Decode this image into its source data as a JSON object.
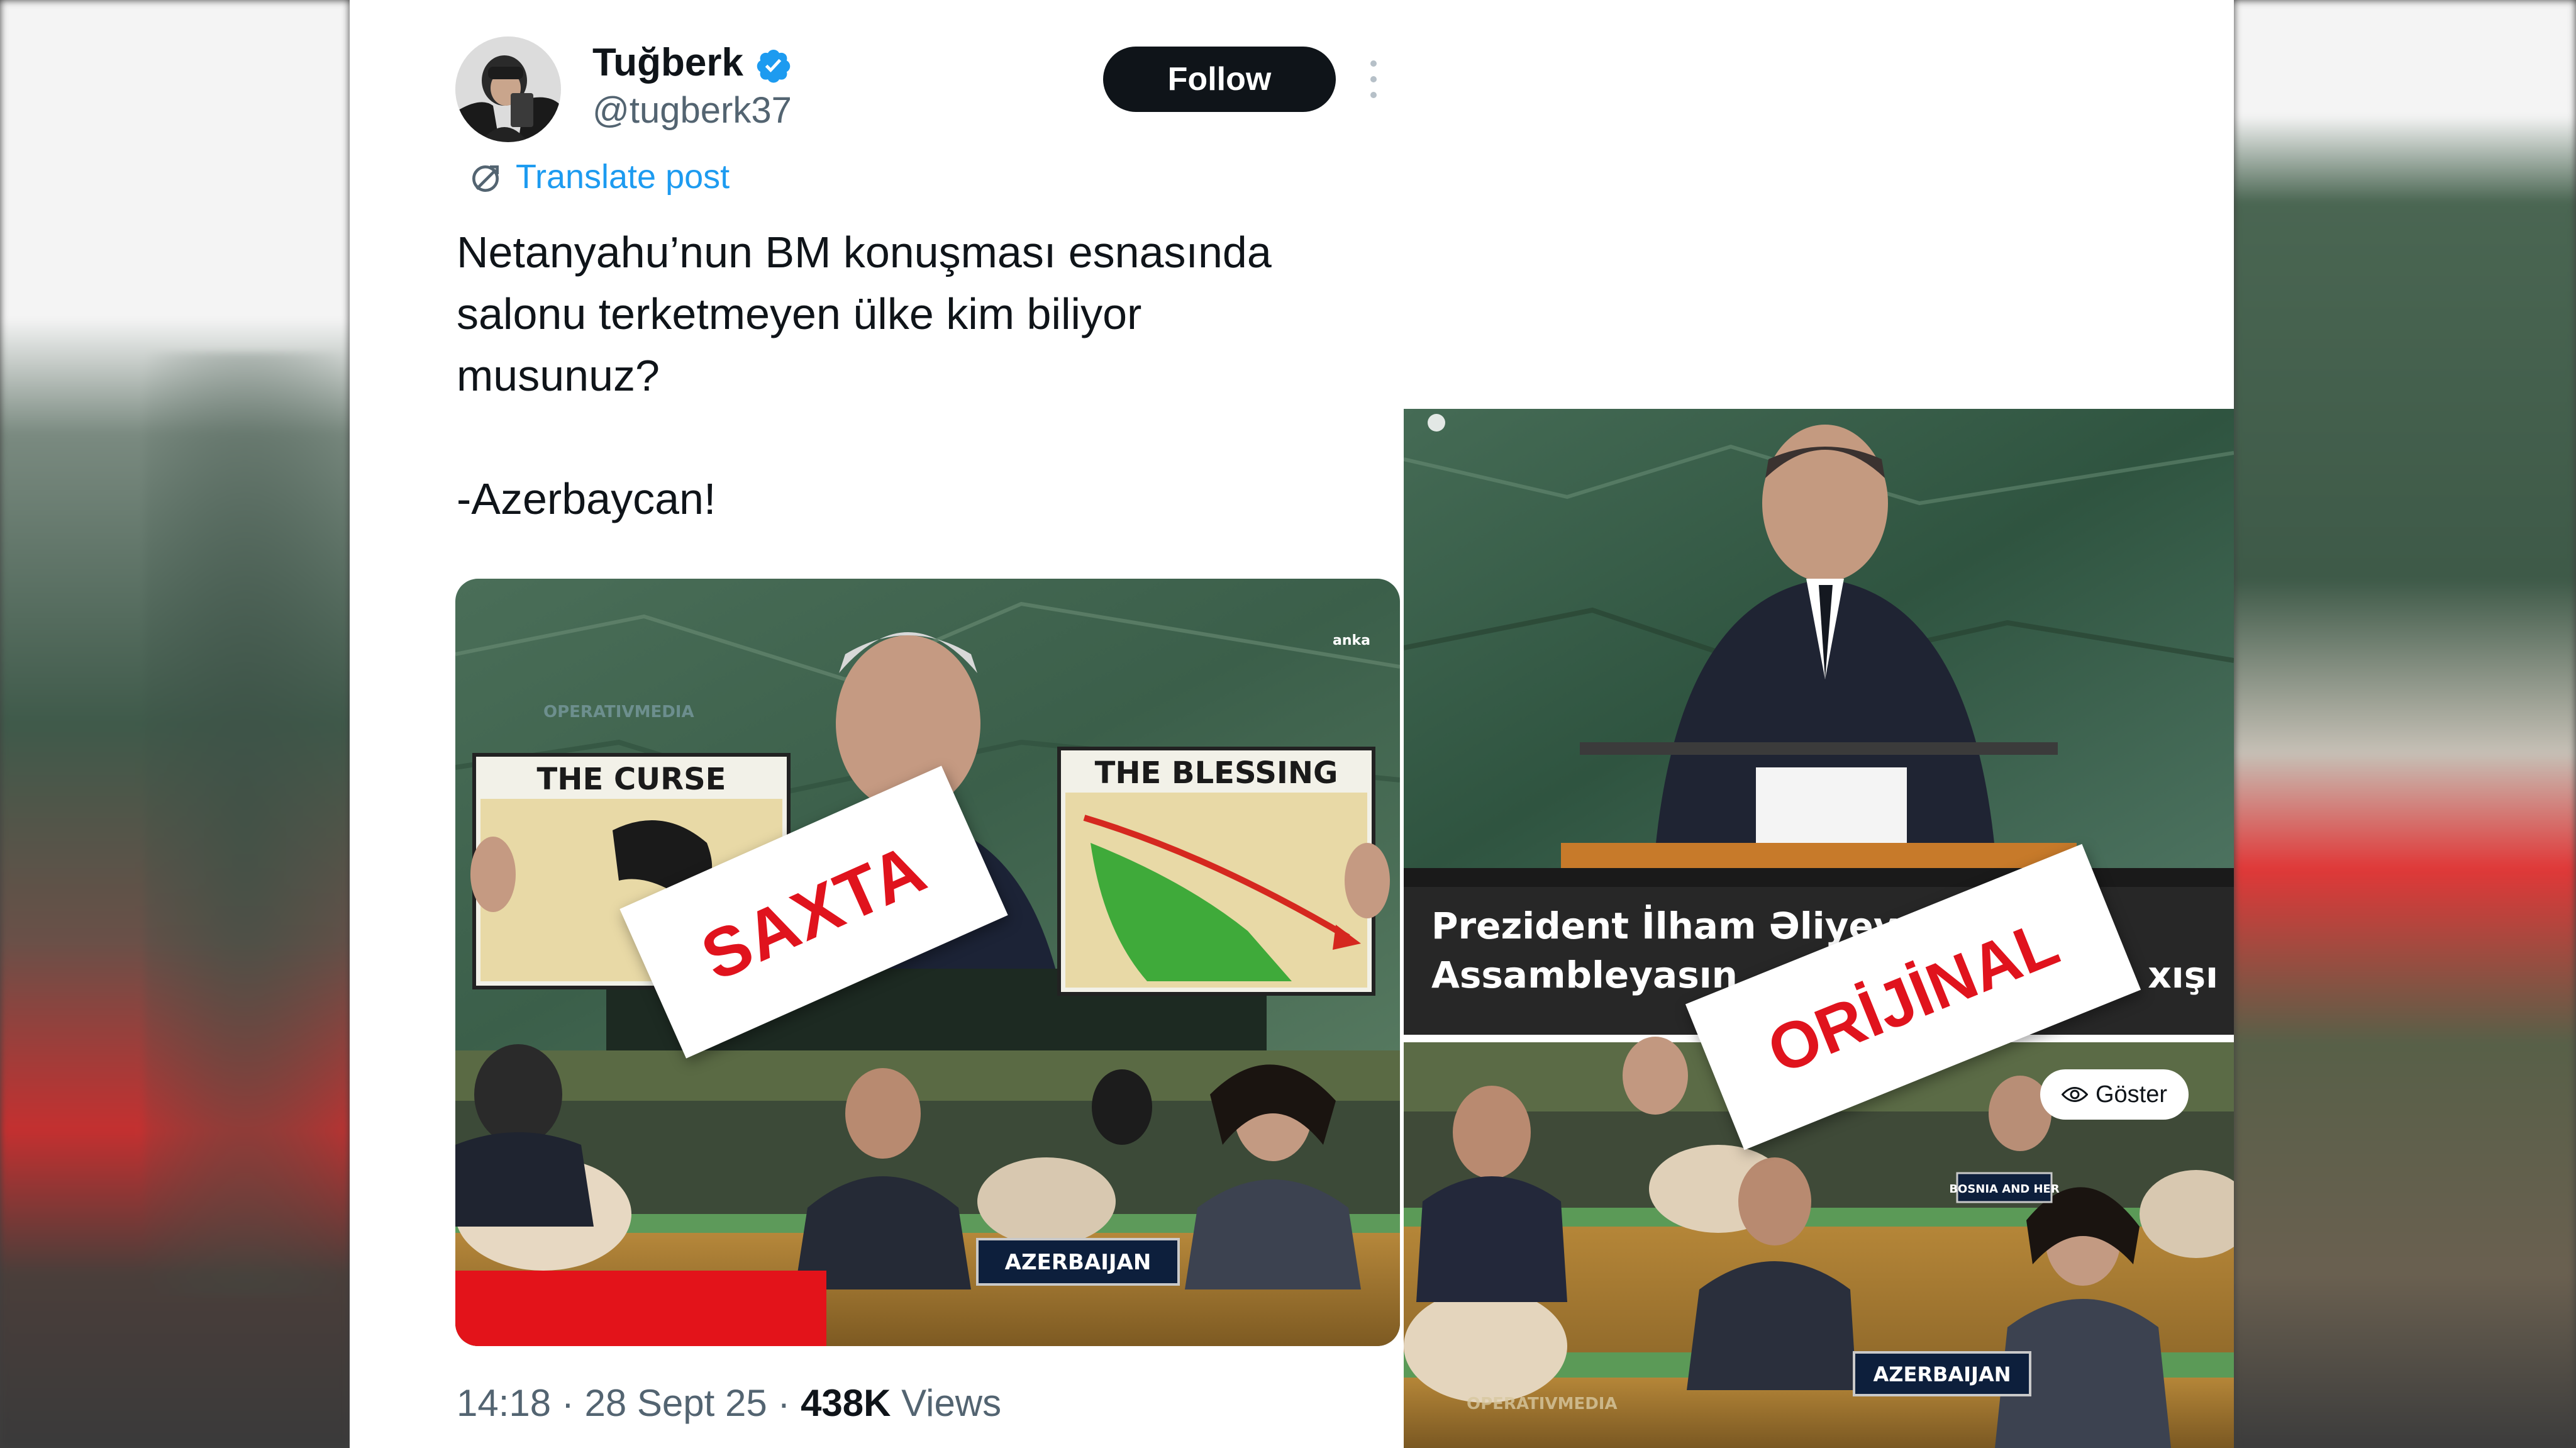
{
  "tweet": {
    "display_name": "Tuğberk",
    "handle": "@tugberk37",
    "follow_label": "Follow",
    "translate_label": "Translate post",
    "text_lines": [
      "Netanyahu’nun BM konuşması esnasında",
      "salonu terketmeyen ülke kim biliyor",
      "musunuz?",
      "",
      "-Azerbaycan!"
    ],
    "time": "14:18",
    "date": "28 Sept 25",
    "views_count": "438K",
    "views_label": "Views",
    "separator": "·"
  },
  "media_left": {
    "stamp_text": "SAXTA",
    "sign_curse": "THE CURSE",
    "sign_blessing": "THE BLESSING",
    "channel_tag": "anka",
    "watermark": "OPERATIVMEDIA",
    "nameplate": "AZERBAIJAN"
  },
  "media_right": {
    "stamp_text": "ORİJİNAL",
    "caption_line1": "Prezident İlham Əliyev",
    "caption_line2": "Assambleyasın",
    "caption_tail": "xışı",
    "nameplate": "AZERBAIJAN",
    "nameplate_other": "BOSNIA AND HER",
    "watermark": "OPERATIVMEDIA",
    "show_label": "Göster"
  },
  "colors": {
    "link_blue": "#1d9bf0",
    "verified_blue": "#1d9bf0",
    "stamp_red": "#e0131d",
    "text_primary": "#0f1419",
    "text_secondary": "#536471"
  },
  "icons": [
    "verified-badge-icon",
    "more-options-icon",
    "translate-icon",
    "eye-icon"
  ]
}
